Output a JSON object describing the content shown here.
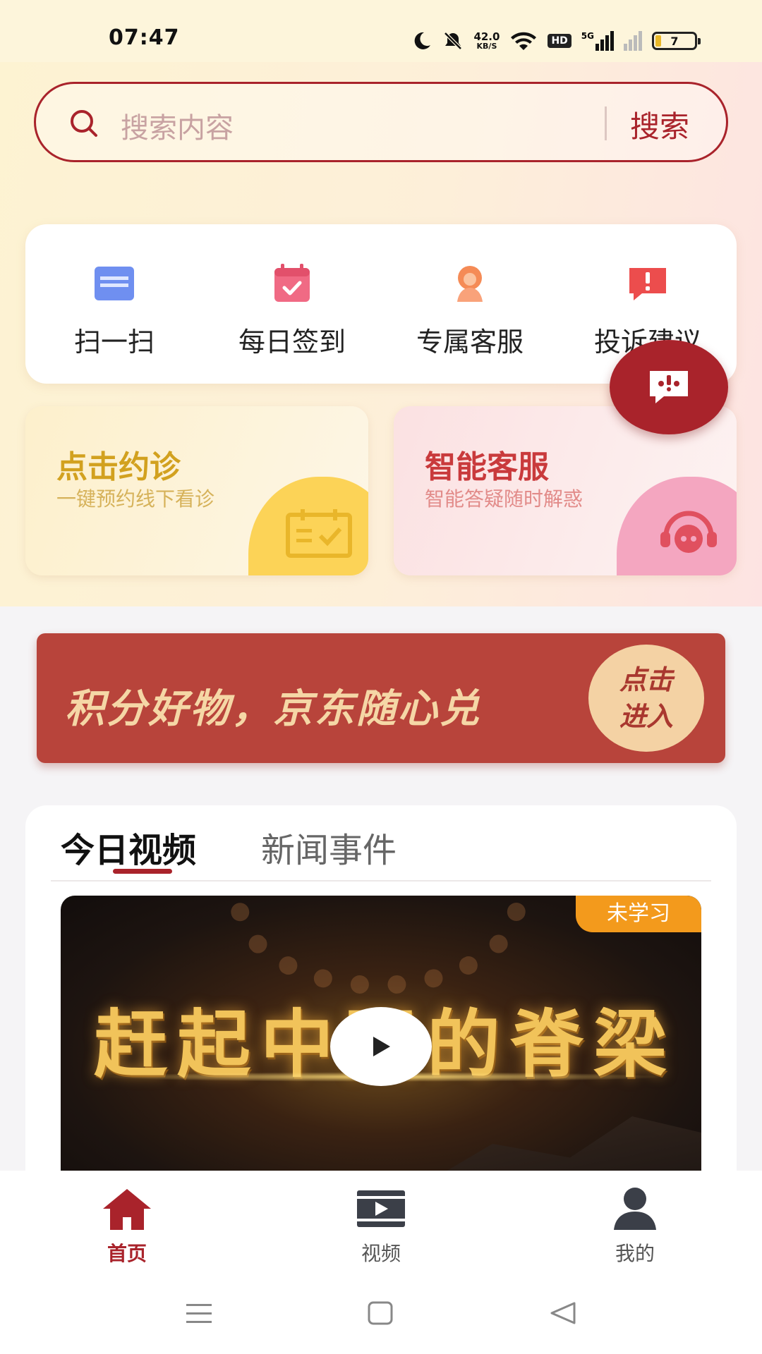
{
  "status_bar": {
    "time": "07:47",
    "net_speed_value": "42.0",
    "net_speed_unit": "KB/S",
    "hd": "HD",
    "network": "5G",
    "battery": "7"
  },
  "search": {
    "placeholder": "搜索内容",
    "button_label": "搜索"
  },
  "quick_actions": [
    {
      "label": "扫一扫",
      "icon": "scan-icon"
    },
    {
      "label": "每日签到",
      "icon": "calendar-check-icon"
    },
    {
      "label": "专属客服",
      "icon": "customer-service-icon"
    },
    {
      "label": "投诉建议",
      "icon": "alert-message-icon"
    }
  ],
  "promos": [
    {
      "title": "点击约诊",
      "subtitle": "一键预约线下看诊",
      "icon": "calendar-icon"
    },
    {
      "title": "智能客服",
      "subtitle": "智能答疑随时解惑",
      "icon": "robot-headset-icon"
    }
  ],
  "banner": {
    "text": "积分好物，京东随心兑",
    "cta_line1": "点击",
    "cta_line2": "进入"
  },
  "tabs": [
    {
      "label": "今日视频",
      "active": true
    },
    {
      "label": "新闻事件",
      "active": false
    }
  ],
  "video": {
    "overlay_text": "赶起中国的脊梁",
    "badge": "未学习"
  },
  "bottom_nav": [
    {
      "label": "首页",
      "icon": "home-icon",
      "active": true
    },
    {
      "label": "视频",
      "icon": "video-icon",
      "active": false
    },
    {
      "label": "我的",
      "icon": "user-icon",
      "active": false
    }
  ],
  "colors": {
    "primary": "#a9232b",
    "badge": "#f39a1c",
    "banner": "#b8443b"
  }
}
